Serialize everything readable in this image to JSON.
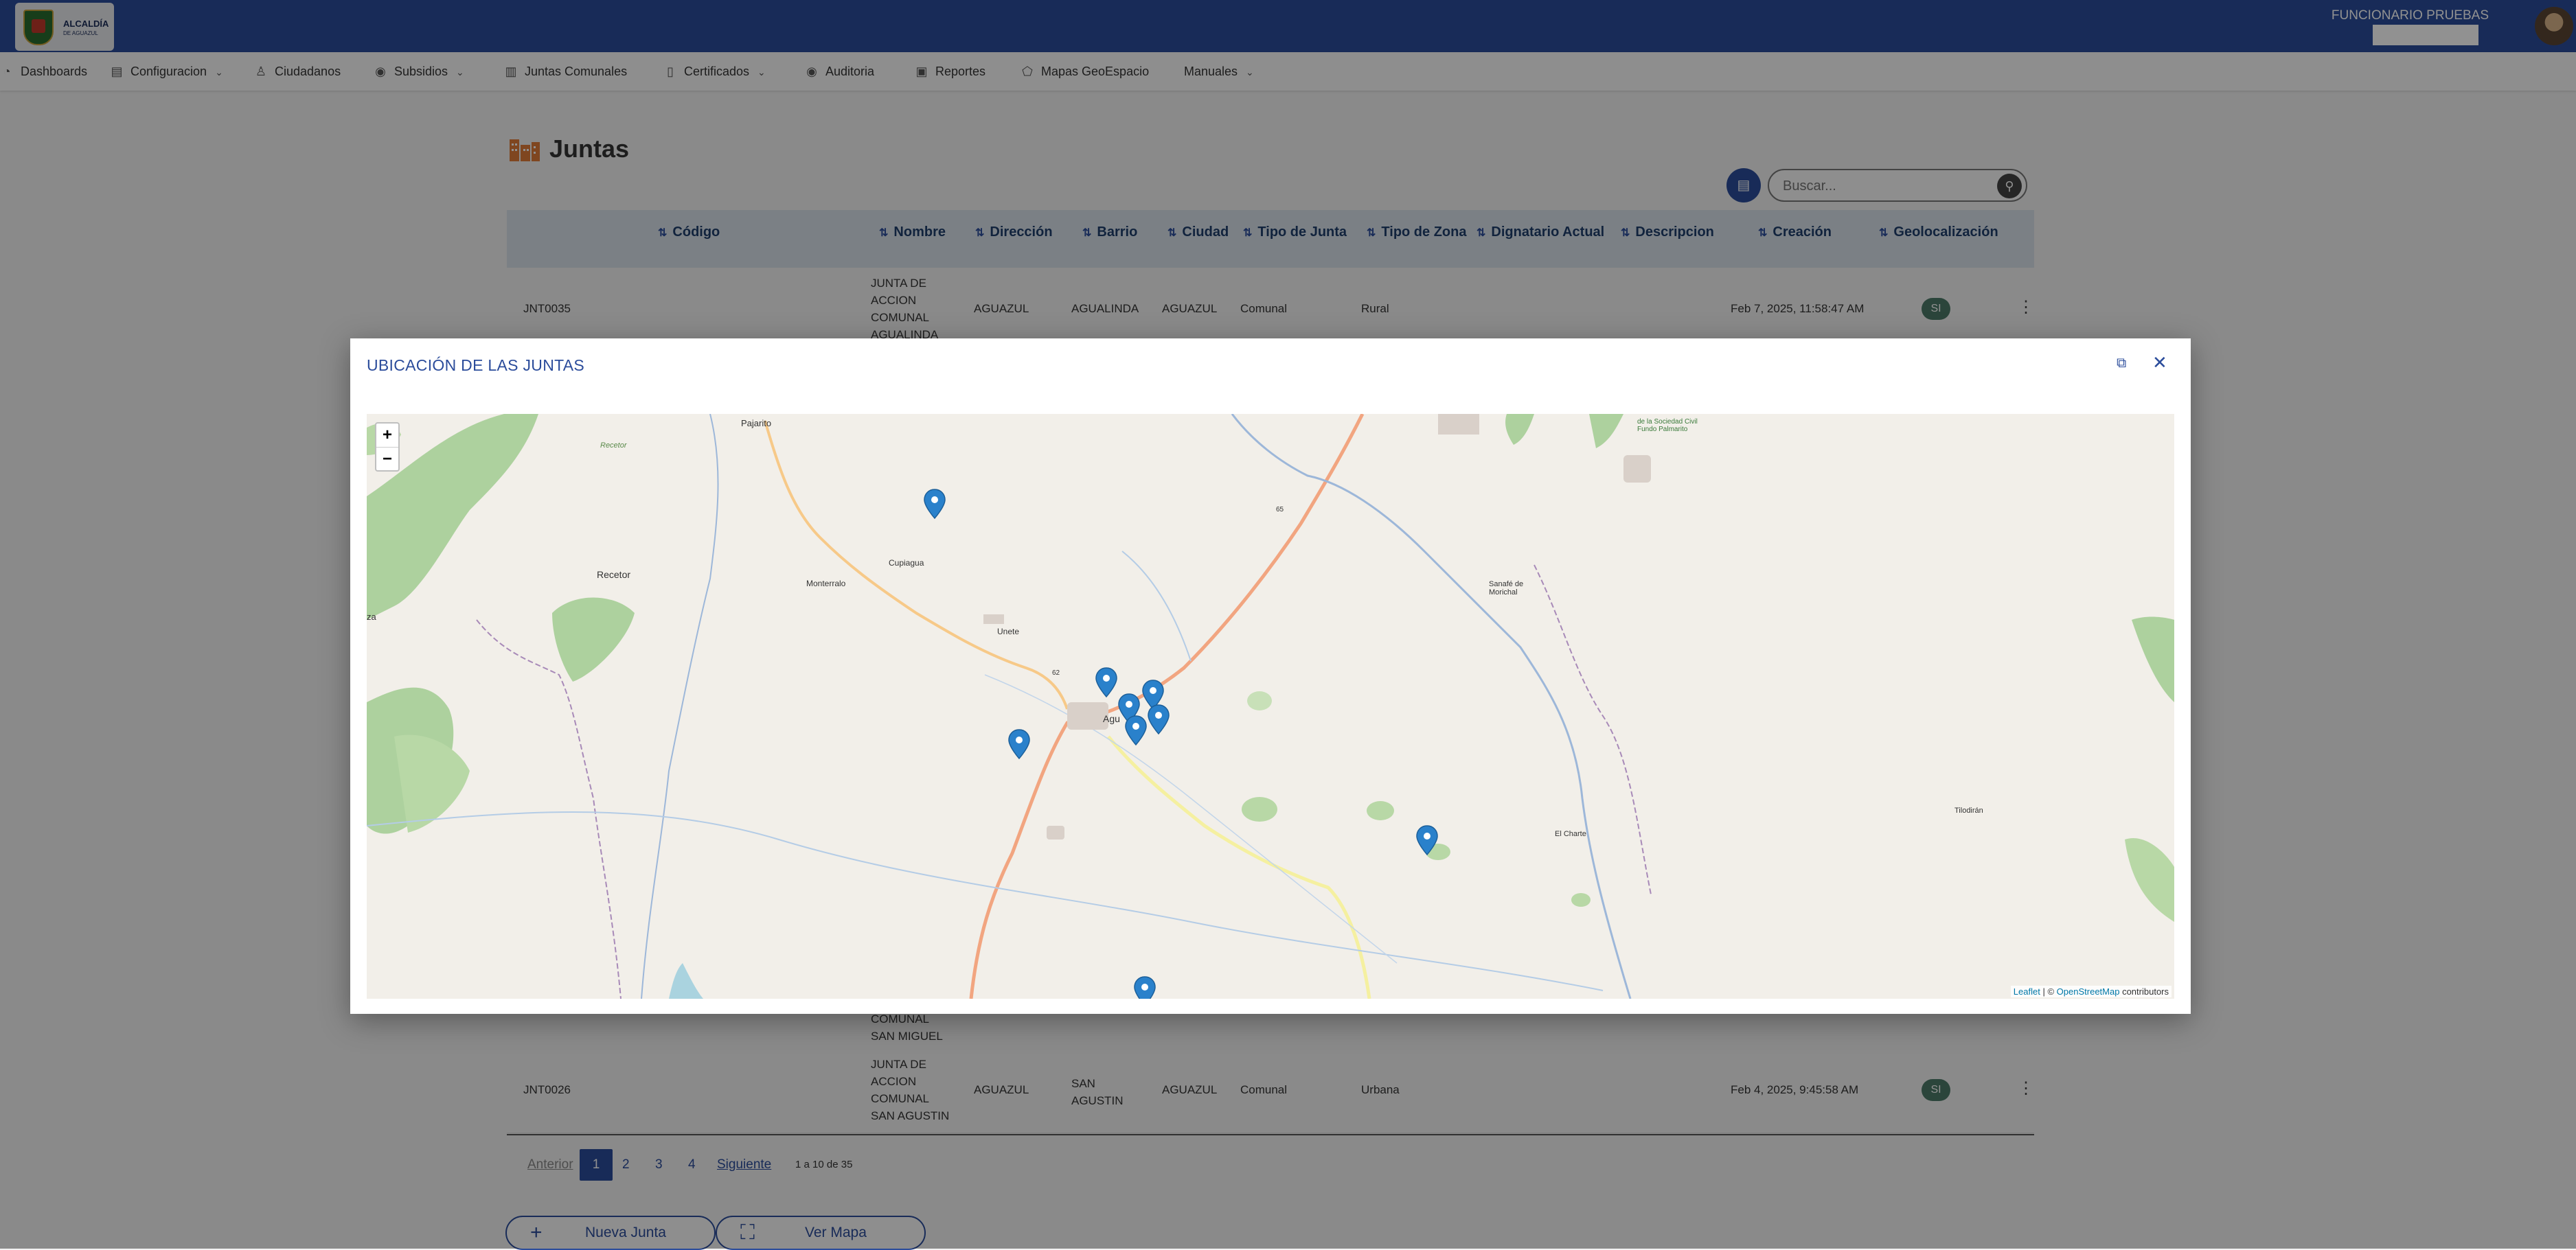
{
  "header": {
    "logo_text": "ALCALDÍA",
    "logo_subtext": "DE AGUAZUL",
    "user_name": "FUNCIONARIO PRUEBAS"
  },
  "nav": {
    "items": [
      {
        "label": "Dashboards",
        "icon": "dashboard-icon",
        "dropdown": false
      },
      {
        "label": "Configuracion",
        "icon": "document-icon",
        "dropdown": true
      },
      {
        "label": "Ciudadanos",
        "icon": "user-icon",
        "dropdown": false
      },
      {
        "label": "Subsidios",
        "icon": "subsidy-icon",
        "dropdown": true
      },
      {
        "label": "Juntas Comunales",
        "icon": "building-icon",
        "dropdown": false
      },
      {
        "label": "Certificados",
        "icon": "certificate-icon",
        "dropdown": true
      },
      {
        "label": "Auditoria",
        "icon": "eye-icon",
        "dropdown": false
      },
      {
        "label": "Reportes",
        "icon": "chart-icon",
        "dropdown": false
      },
      {
        "label": "Mapas GeoEspacio",
        "icon": "map-icon",
        "dropdown": false
      },
      {
        "label": "Manuales",
        "icon": "book-icon",
        "dropdown": true
      }
    ]
  },
  "page": {
    "title": "Juntas",
    "search_placeholder": "Buscar..."
  },
  "table": {
    "columns": [
      "Código",
      "Nombre",
      "Dirección",
      "Barrio",
      "Ciudad",
      "Tipo de Junta",
      "Tipo de Zona",
      "Dignatario Actual",
      "Descripcion",
      "Creación",
      "Geolocalización"
    ],
    "rows": [
      {
        "codigo": "JNT0035",
        "nombre": "JUNTA DE ACCION COMUNAL AGUALINDA",
        "direccion": "AGUAZUL",
        "barrio": "AGUALINDA",
        "ciudad": "AGUAZUL",
        "tipo_junta": "Comunal",
        "tipo_zona": "Rural",
        "dignatario": "",
        "descripcion": "",
        "creacion": "Feb 7, 2025, 11:58:47 AM",
        "geo": "SI"
      },
      {
        "codigo": "",
        "nombre": "COMUNAL SAN MIGUEL",
        "direccion": "",
        "barrio": "",
        "ciudad": "",
        "tipo_junta": "",
        "tipo_zona": "",
        "dignatario": "",
        "descripcion": "",
        "creacion": "",
        "geo": ""
      },
      {
        "codigo": "JNT0026",
        "nombre": "JUNTA DE ACCION COMUNAL SAN AGUSTIN",
        "direccion": "AGUAZUL",
        "barrio": "SAN AGUSTIN",
        "ciudad": "AGUAZUL",
        "tipo_junta": "Comunal",
        "tipo_zona": "Urbana",
        "dignatario": "",
        "descripcion": "",
        "creacion": "Feb 4, 2025, 9:45:58 AM",
        "geo": "SI"
      }
    ]
  },
  "pagination": {
    "prev": "Anterior",
    "pages": [
      "1",
      "2",
      "3",
      "4"
    ],
    "current": "1",
    "next": "Siguiente",
    "info": "1 a 10 de 35"
  },
  "actions": {
    "new_label": "Nueva Junta",
    "map_label": "Ver Mapa"
  },
  "modal": {
    "title": "UBICACIÓN DE LAS JUNTAS",
    "zoom_in": "+",
    "zoom_out": "−",
    "attribution_leaflet": "Leaflet",
    "attribution_sep": "| ©",
    "attribution_osm": "OpenStreetMap",
    "attribution_tail": "contributors",
    "place_labels": [
      "Pajarito",
      "Recetor",
      "Monterralo",
      "Cupiagua",
      "Unete",
      "Agu",
      "Sanafé de Morichal",
      "Tilodirán",
      "El Charte",
      "65",
      "62",
      "Recetor",
      "za",
      "de la Sociedad Civil Fundo Palmarito"
    ],
    "markers_count": 11
  },
  "colors": {
    "primary": "#2b4c9b",
    "marker": "#2a81cb",
    "badge": "#4c7a68"
  }
}
